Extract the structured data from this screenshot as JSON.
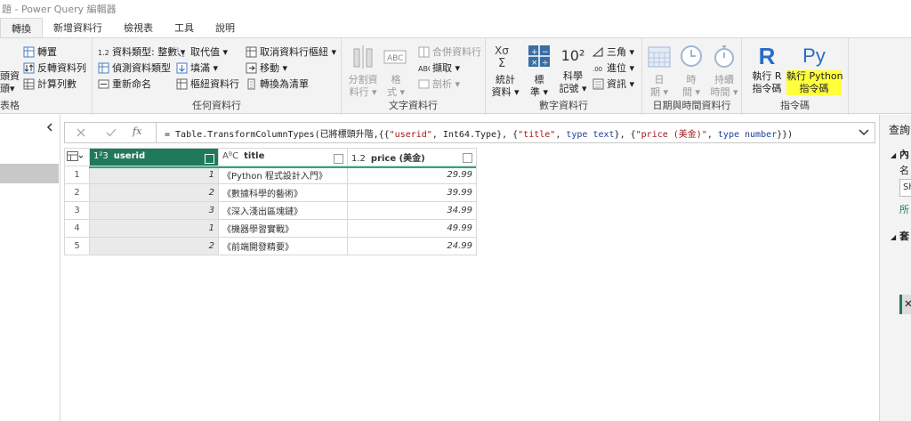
{
  "window": {
    "title": "題 - Power Query 編輯器"
  },
  "tabs": [
    "轉換",
    "新增資料行",
    "檢視表",
    "工具",
    "說明"
  ],
  "ribbon": {
    "table_group": {
      "label": "表格",
      "transpose": "轉置",
      "reverse_rows": "反轉資料列",
      "count_rows": "計算列數",
      "cut_use_headers_1": "頭資",
      "cut_use_headers_2": "頭▾"
    },
    "any_column_group": {
      "label": "任何資料行",
      "data_type": "資料類型: 整數 ▾",
      "detect_type": "偵測資料類型",
      "rename": "重新命名",
      "replace_values": "取代值 ▾",
      "fill": "填滿 ▾",
      "pivot_column": "樞紐資料行",
      "unpivot": "取消資料行樞紐 ▾",
      "move": "移動 ▾",
      "convert_to_list": "轉換為清單"
    },
    "text_column_group": {
      "label": "文字資料行",
      "split_column": "分割資\n料行 ▾",
      "format": "格\n式 ▾",
      "merge_columns": "合併資料行",
      "extract": "擷取 ▾",
      "parse": "剖析 ▾"
    },
    "number_column_group": {
      "label": "數字資料行",
      "statistics": "統計\n資料 ▾",
      "standard": "標\n準 ▾",
      "scientific": "科學\n記號 ▾",
      "trig": "三角 ▾",
      "rounding": "進位 ▾",
      "information": "資訊 ▾",
      "sci_icon": "10²"
    },
    "datetime_group": {
      "label": "日期與時間資料行",
      "date": "日\n期 ▾",
      "time": "時\n間 ▾",
      "duration": "持續\n時間 ▾"
    },
    "scripts_group": {
      "label": "指令碼",
      "run_r": "執行 R\n指令碼",
      "run_python": "執行 Python\n指令碼",
      "r_icon": "R",
      "py_icon": "Py"
    }
  },
  "formula_bar": {
    "fx": "fx",
    "prefix": "= Table.TransformColumnTypes(已將標頭升階,{{",
    "s1": "\"userid\"",
    "p2": ", Int64.Type}, {",
    "s2": "\"title\"",
    "p3": ", ",
    "k1": "type text",
    "p4": "}, {",
    "s3": "\"price (美金)\"",
    "p5": ", ",
    "k2": "type number",
    "p6": "}})"
  },
  "table": {
    "columns": [
      {
        "type_icon": "1²3",
        "name": "userid"
      },
      {
        "type_icon": "AᴮC",
        "name": "title"
      },
      {
        "type_icon": "1.2",
        "name": "price (美金)"
      }
    ],
    "rows": [
      {
        "n": "1",
        "userid": "1",
        "title": "《Python 程式設計入門》",
        "price": "29.99"
      },
      {
        "n": "2",
        "userid": "2",
        "title": "《數據科學的藝術》",
        "price": "39.99"
      },
      {
        "n": "3",
        "userid": "3",
        "title": "《深入淺出區塊鏈》",
        "price": "34.99"
      },
      {
        "n": "4",
        "userid": "1",
        "title": "《機器學習實戰》",
        "price": "49.99"
      },
      {
        "n": "5",
        "userid": "2",
        "title": "《前端開發精要》",
        "price": "24.99"
      }
    ]
  },
  "right_pane": {
    "title": "查詢",
    "section1": "內",
    "name_label": "名",
    "name_value": "Sh",
    "all_props": "所",
    "section2": "套"
  },
  "colors": {
    "accent": "#21795b",
    "highlight": "#ffff3b",
    "r_blue": "#2b6cc4"
  }
}
